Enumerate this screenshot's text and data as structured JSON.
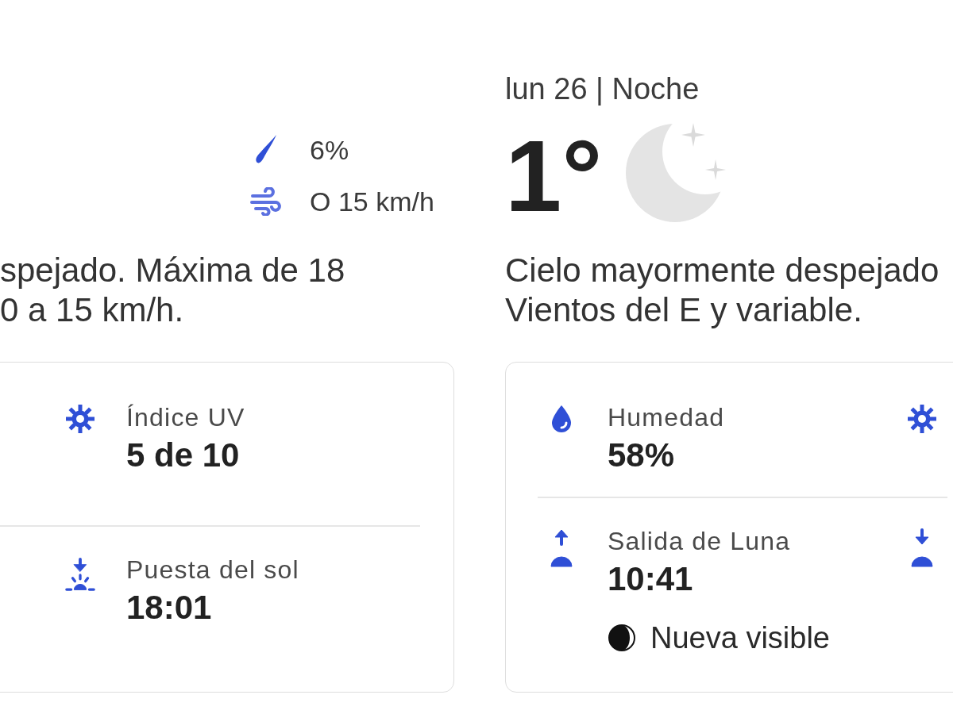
{
  "forecast_columns": [
    {
      "conditions": [
        {
          "kind": "precipitation",
          "value": "6%"
        },
        {
          "kind": "wind",
          "value": "O 15 km/h"
        }
      ],
      "description_lines": [
        "spejado. Máxima de 18",
        "0 a 15 km/h."
      ],
      "detail_rows": [
        {
          "items": [
            {
              "kind": "uv",
              "label": "Índice UV",
              "value": "5 de 10"
            }
          ]
        },
        {
          "items": [
            {
              "kind": "sunset",
              "label": "Puesta del sol",
              "value": "18:01"
            }
          ]
        }
      ]
    },
    {
      "heading": "lun 26 | Noche",
      "temperature": "1°",
      "description_lines": [
        "Cielo mayormente despejado",
        "Vientos del E y variable."
      ],
      "detail_rows": [
        {
          "items": [
            {
              "kind": "humidity",
              "label": "Humedad",
              "value": "58%"
            },
            {
              "kind": "uv"
            }
          ]
        },
        {
          "items": [
            {
              "kind": "moonrise",
              "label": "Salida de Luna",
              "value": "10:41",
              "moon_phase": "Nueva visible"
            },
            {
              "kind": "moonset"
            }
          ]
        }
      ]
    }
  ]
}
